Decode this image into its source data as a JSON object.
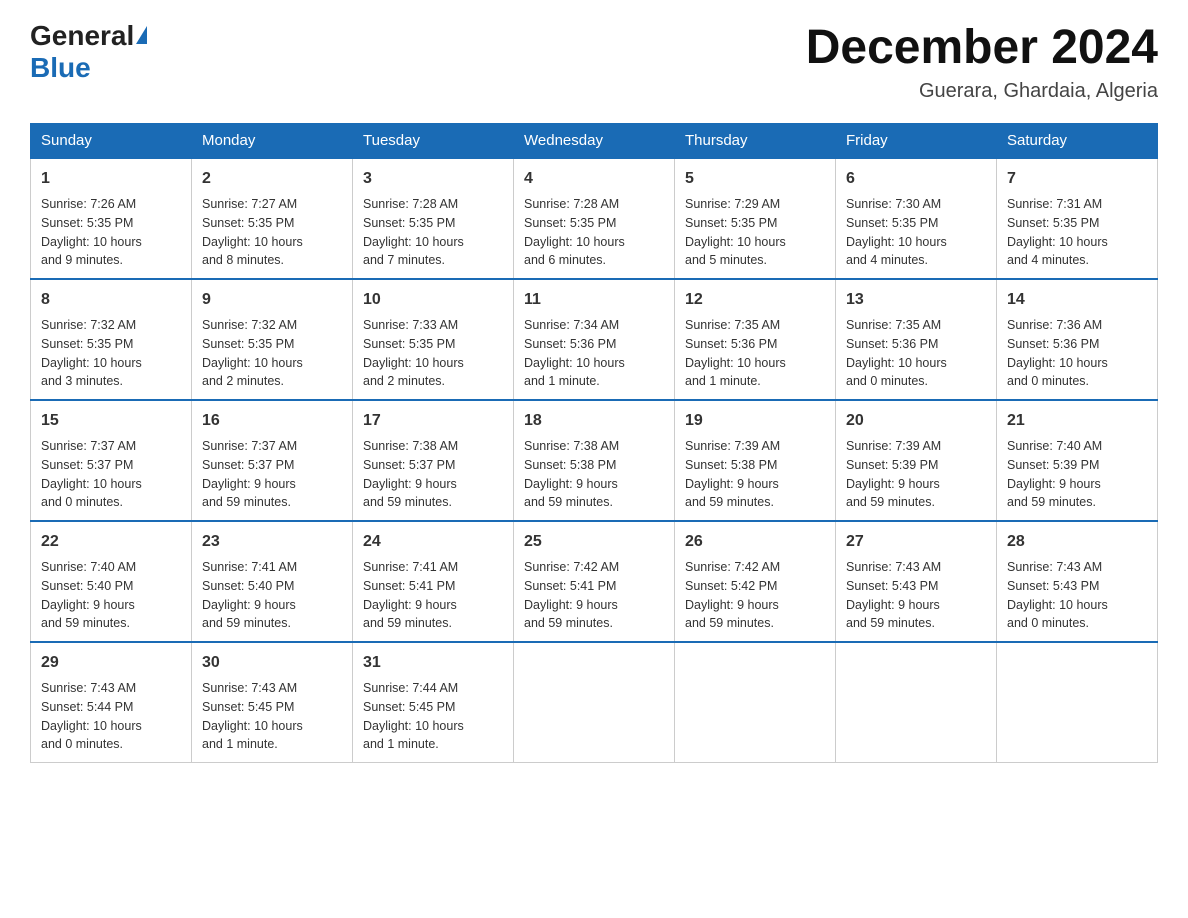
{
  "header": {
    "logo_general": "General",
    "logo_blue": "Blue",
    "title": "December 2024",
    "subtitle": "Guerara, Ghardaia, Algeria"
  },
  "days": [
    "Sunday",
    "Monday",
    "Tuesday",
    "Wednesday",
    "Thursday",
    "Friday",
    "Saturday"
  ],
  "weeks": [
    [
      {
        "num": "1",
        "info": "Sunrise: 7:26 AM\nSunset: 5:35 PM\nDaylight: 10 hours\nand 9 minutes."
      },
      {
        "num": "2",
        "info": "Sunrise: 7:27 AM\nSunset: 5:35 PM\nDaylight: 10 hours\nand 8 minutes."
      },
      {
        "num": "3",
        "info": "Sunrise: 7:28 AM\nSunset: 5:35 PM\nDaylight: 10 hours\nand 7 minutes."
      },
      {
        "num": "4",
        "info": "Sunrise: 7:28 AM\nSunset: 5:35 PM\nDaylight: 10 hours\nand 6 minutes."
      },
      {
        "num": "5",
        "info": "Sunrise: 7:29 AM\nSunset: 5:35 PM\nDaylight: 10 hours\nand 5 minutes."
      },
      {
        "num": "6",
        "info": "Sunrise: 7:30 AM\nSunset: 5:35 PM\nDaylight: 10 hours\nand 4 minutes."
      },
      {
        "num": "7",
        "info": "Sunrise: 7:31 AM\nSunset: 5:35 PM\nDaylight: 10 hours\nand 4 minutes."
      }
    ],
    [
      {
        "num": "8",
        "info": "Sunrise: 7:32 AM\nSunset: 5:35 PM\nDaylight: 10 hours\nand 3 minutes."
      },
      {
        "num": "9",
        "info": "Sunrise: 7:32 AM\nSunset: 5:35 PM\nDaylight: 10 hours\nand 2 minutes."
      },
      {
        "num": "10",
        "info": "Sunrise: 7:33 AM\nSunset: 5:35 PM\nDaylight: 10 hours\nand 2 minutes."
      },
      {
        "num": "11",
        "info": "Sunrise: 7:34 AM\nSunset: 5:36 PM\nDaylight: 10 hours\nand 1 minute."
      },
      {
        "num": "12",
        "info": "Sunrise: 7:35 AM\nSunset: 5:36 PM\nDaylight: 10 hours\nand 1 minute."
      },
      {
        "num": "13",
        "info": "Sunrise: 7:35 AM\nSunset: 5:36 PM\nDaylight: 10 hours\nand 0 minutes."
      },
      {
        "num": "14",
        "info": "Sunrise: 7:36 AM\nSunset: 5:36 PM\nDaylight: 10 hours\nand 0 minutes."
      }
    ],
    [
      {
        "num": "15",
        "info": "Sunrise: 7:37 AM\nSunset: 5:37 PM\nDaylight: 10 hours\nand 0 minutes."
      },
      {
        "num": "16",
        "info": "Sunrise: 7:37 AM\nSunset: 5:37 PM\nDaylight: 9 hours\nand 59 minutes."
      },
      {
        "num": "17",
        "info": "Sunrise: 7:38 AM\nSunset: 5:37 PM\nDaylight: 9 hours\nand 59 minutes."
      },
      {
        "num": "18",
        "info": "Sunrise: 7:38 AM\nSunset: 5:38 PM\nDaylight: 9 hours\nand 59 minutes."
      },
      {
        "num": "19",
        "info": "Sunrise: 7:39 AM\nSunset: 5:38 PM\nDaylight: 9 hours\nand 59 minutes."
      },
      {
        "num": "20",
        "info": "Sunrise: 7:39 AM\nSunset: 5:39 PM\nDaylight: 9 hours\nand 59 minutes."
      },
      {
        "num": "21",
        "info": "Sunrise: 7:40 AM\nSunset: 5:39 PM\nDaylight: 9 hours\nand 59 minutes."
      }
    ],
    [
      {
        "num": "22",
        "info": "Sunrise: 7:40 AM\nSunset: 5:40 PM\nDaylight: 9 hours\nand 59 minutes."
      },
      {
        "num": "23",
        "info": "Sunrise: 7:41 AM\nSunset: 5:40 PM\nDaylight: 9 hours\nand 59 minutes."
      },
      {
        "num": "24",
        "info": "Sunrise: 7:41 AM\nSunset: 5:41 PM\nDaylight: 9 hours\nand 59 minutes."
      },
      {
        "num": "25",
        "info": "Sunrise: 7:42 AM\nSunset: 5:41 PM\nDaylight: 9 hours\nand 59 minutes."
      },
      {
        "num": "26",
        "info": "Sunrise: 7:42 AM\nSunset: 5:42 PM\nDaylight: 9 hours\nand 59 minutes."
      },
      {
        "num": "27",
        "info": "Sunrise: 7:43 AM\nSunset: 5:43 PM\nDaylight: 9 hours\nand 59 minutes."
      },
      {
        "num": "28",
        "info": "Sunrise: 7:43 AM\nSunset: 5:43 PM\nDaylight: 10 hours\nand 0 minutes."
      }
    ],
    [
      {
        "num": "29",
        "info": "Sunrise: 7:43 AM\nSunset: 5:44 PM\nDaylight: 10 hours\nand 0 minutes."
      },
      {
        "num": "30",
        "info": "Sunrise: 7:43 AM\nSunset: 5:45 PM\nDaylight: 10 hours\nand 1 minute."
      },
      {
        "num": "31",
        "info": "Sunrise: 7:44 AM\nSunset: 5:45 PM\nDaylight: 10 hours\nand 1 minute."
      },
      null,
      null,
      null,
      null
    ]
  ]
}
